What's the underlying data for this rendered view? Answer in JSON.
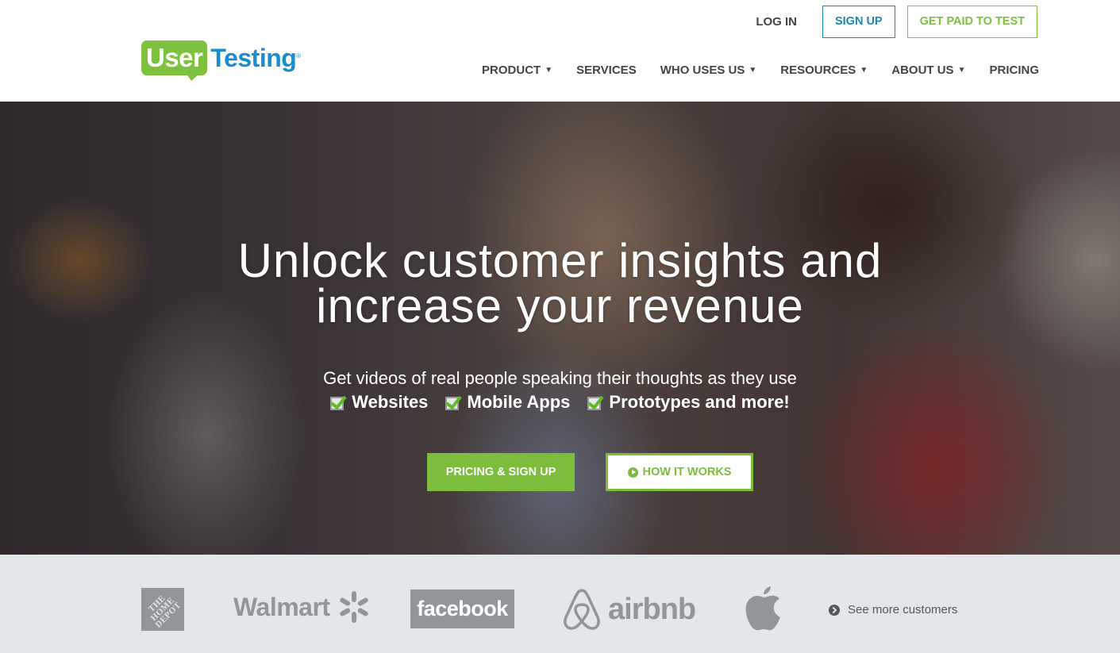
{
  "brand": {
    "logo_part1": "User",
    "logo_part2": "Testing",
    "logo_reg": "®",
    "colors": {
      "green": "#7dc13f",
      "blue": "#1a8dd1"
    }
  },
  "top_links": {
    "login": "LOG IN",
    "signup": "SIGN UP",
    "get_paid": "GET PAID TO TEST"
  },
  "nav": {
    "items": [
      {
        "label": "PRODUCT",
        "dropdown": true,
        "icon": "caret-down-icon"
      },
      {
        "label": "SERVICES",
        "dropdown": false
      },
      {
        "label": "WHO USES US",
        "dropdown": true,
        "icon": "caret-down-icon"
      },
      {
        "label": "RESOURCES",
        "dropdown": true,
        "icon": "caret-down-icon"
      },
      {
        "label": "ABOUT US",
        "dropdown": true,
        "icon": "caret-down-icon"
      },
      {
        "label": "PRICING",
        "dropdown": false
      }
    ],
    "caret": "▼"
  },
  "hero": {
    "title_line1": "Unlock customer insights and",
    "title_line2": "increase your revenue",
    "subtitle": "Get videos of real people speaking their thoughts as they use",
    "features": [
      {
        "label": "Websites",
        "icon": "checkbox-checked-icon"
      },
      {
        "label": "Mobile Apps",
        "icon": "checkbox-checked-icon"
      },
      {
        "label": "Prototypes and more!",
        "icon": "checkbox-checked-icon"
      }
    ],
    "primary_cta": "PRICING & SIGN UP",
    "secondary_cta": "HOW IT WORKS",
    "secondary_cta_icon": "play-circle-icon"
  },
  "customers": {
    "logos": [
      {
        "name": "The Home Depot",
        "text": "THE HOME DEPOT"
      },
      {
        "name": "Walmart",
        "text": "Walmart"
      },
      {
        "name": "Facebook",
        "text": "facebook"
      },
      {
        "name": "Airbnb",
        "text": "airbnb"
      },
      {
        "name": "Apple",
        "text": ""
      }
    ],
    "see_more": "See more customers",
    "see_more_icon": "chevron-circle-right-icon"
  }
}
